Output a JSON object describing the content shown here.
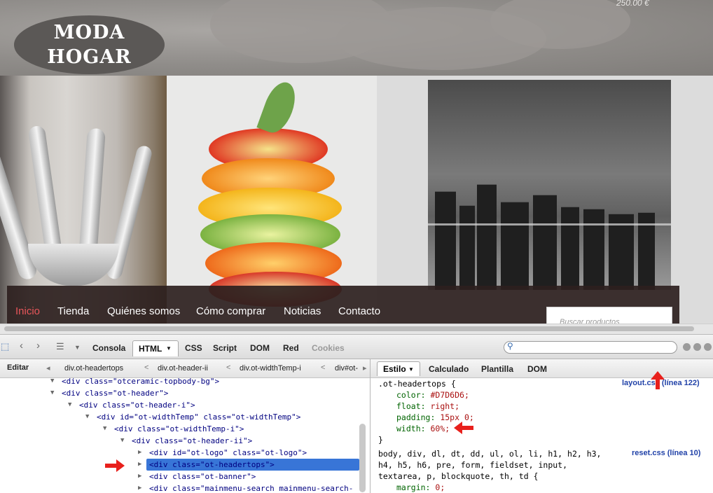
{
  "site": {
    "price": "250.00 €",
    "logo": {
      "line1": "MODA",
      "line2": "HOGAR"
    },
    "menu": [
      {
        "label": "Inicio",
        "active": true
      },
      {
        "label": "Tienda",
        "active": false
      },
      {
        "label": "Quiénes somos",
        "active": false
      },
      {
        "label": "Cómo comprar",
        "active": false
      },
      {
        "label": "Noticias",
        "active": false
      },
      {
        "label": "Contacto",
        "active": false
      }
    ],
    "search_placeholder": "Buscar productos"
  },
  "firebug": {
    "tabs": [
      {
        "label": "Consola",
        "state": "normal"
      },
      {
        "label": "HTML",
        "state": "selected"
      },
      {
        "label": "CSS",
        "state": "normal"
      },
      {
        "label": "Script",
        "state": "normal"
      },
      {
        "label": "DOM",
        "state": "normal"
      },
      {
        "label": "Red",
        "state": "normal"
      },
      {
        "label": "Cookies",
        "state": "disabled"
      }
    ],
    "edit_label": "Editar",
    "breadcrumbs": [
      "div.ot-headertops",
      "div.ot-header-ii",
      "div.ot-widthTemp-i",
      "div#ot-"
    ],
    "tree": [
      {
        "text": "<div class=\"otceramic-topbody-bg\">"
      },
      {
        "text": "<div class=\"ot-header\">"
      },
      {
        "text": "<div class=\"ot-header-i\">"
      },
      {
        "text": "<div id=\"ot-widthTemp\" class=\"ot-widthTemp\">"
      },
      {
        "text": "<div class=\"ot-widthTemp-i\">"
      },
      {
        "text": "<div class=\"ot-header-ii\">"
      },
      {
        "text": "<div id=\"ot-logo\" class=\"ot-logo\">"
      },
      {
        "text": "<div class=\"ot-headertops\">"
      },
      {
        "text": "<div class=\"ot-banner\">"
      },
      {
        "text": "<div class=\"mainmenu-search mainmenu-search-"
      }
    ],
    "side_tabs": [
      "Estilo",
      "Calculado",
      "Plantilla",
      "DOM"
    ],
    "css_rules": [
      {
        "selector": ".ot-headertops {",
        "source": "layout.css (línea 122)",
        "props": [
          {
            "name": "color:",
            "value": "#D7D6D6;"
          },
          {
            "name": "float:",
            "value": "right;"
          },
          {
            "name": "padding:",
            "value": "15px 0;"
          },
          {
            "name": "width:",
            "value": "60%;"
          }
        ],
        "close": "}"
      },
      {
        "selector_lines": [
          "body, div, dl, dt, dd, ul, ol, li, h1, h2, h3,",
          "h4, h5, h6, pre, form, fieldset, input,",
          "textarea, p, blockquote, th, td {"
        ],
        "source": "reset.css (línea 10)",
        "props": [
          {
            "name": "margin:",
            "value": "0;"
          }
        ],
        "close": "}"
      }
    ]
  },
  "colors": {
    "menu_active": "#e8565a",
    "selection": "#3875d7",
    "arrow": "#e8201c",
    "css_source_link": "#2142a8"
  }
}
